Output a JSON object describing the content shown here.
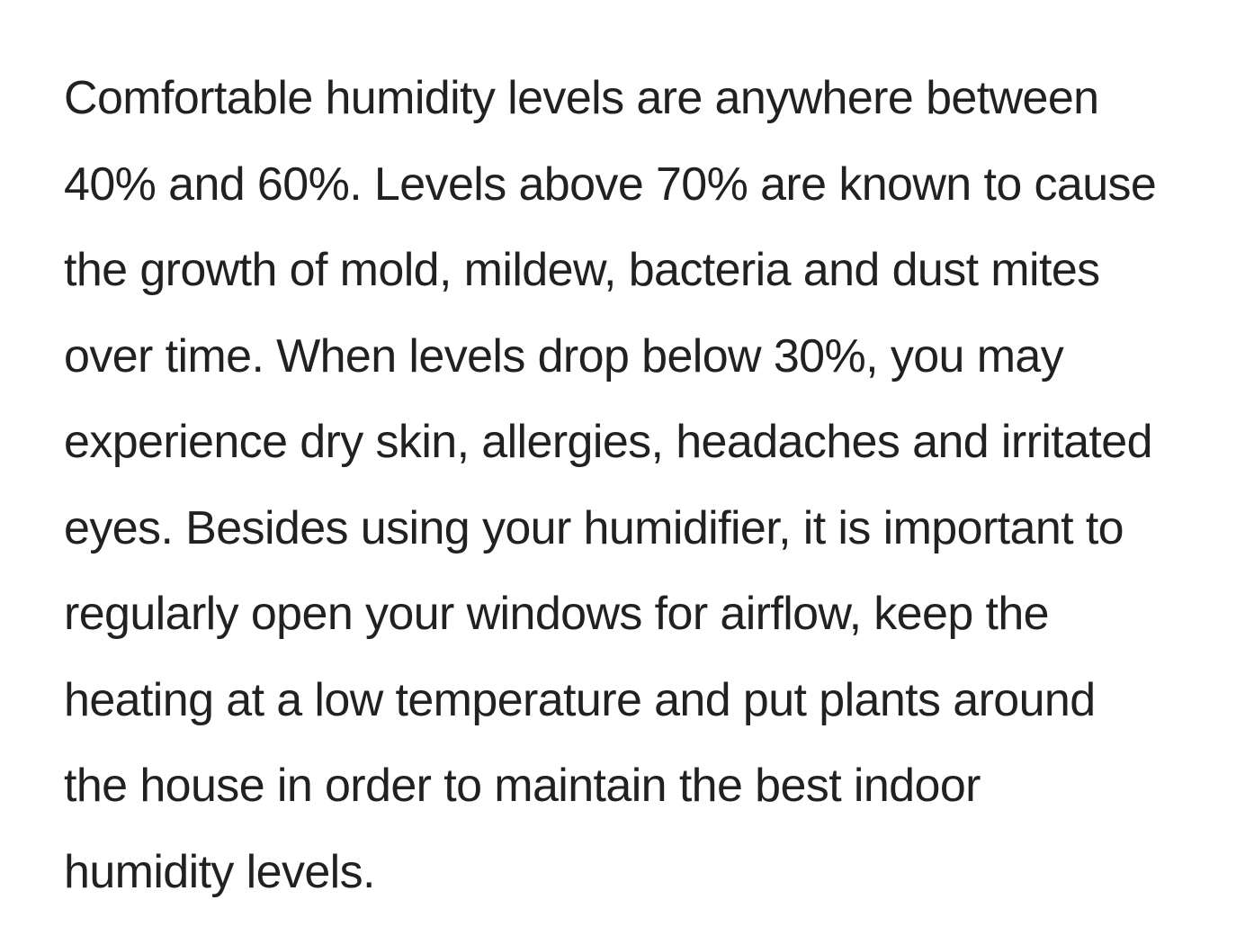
{
  "article": {
    "lines": [
      "Comfortable humidity levels are anywhere between",
      "40% and 60%. Levels above 70% are known to cause",
      "the growth of mold, mildew, bacteria and dust mites",
      "over time. When levels drop below 30%, you may",
      "experience dry skin, allergies, headaches and irritated",
      "eyes. Besides using your humidifier, it is important to",
      "regularly open your windows for airflow, keep the",
      "heating at a low temperature and put plants around",
      "the house in order to maintain the best indoor",
      "humidity levels."
    ]
  },
  "colors": {
    "text": "#212121",
    "background": "#ffffff"
  }
}
